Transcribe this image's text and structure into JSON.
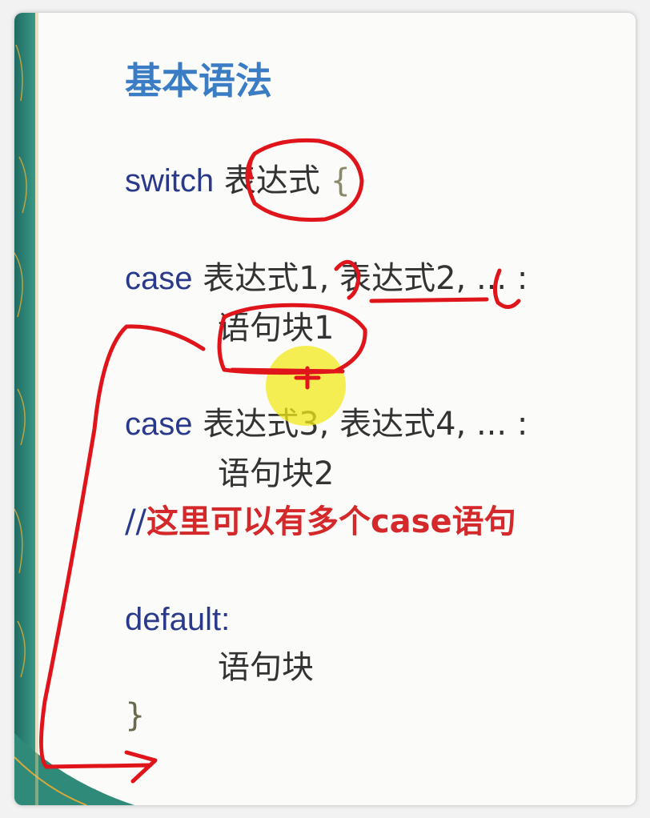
{
  "slide": {
    "title": "基本语法",
    "switch_kw": "switch",
    "switch_expr": "表达式",
    "open_brace": "{",
    "case1_kw": "case",
    "case1_rest": " 表达式1, 表达式2, ... :",
    "block1": "语句块1",
    "case2_kw": "case",
    "case2_rest": " 表达式3, 表达式4, ... :",
    "block2": "语句块2",
    "comment_slash": "//",
    "comment_text": "这里可以有多个case语句",
    "default_kw": "default:",
    "default_block": "语句块",
    "close_brace": "}"
  },
  "colors": {
    "title": "#3a7dc4",
    "keyword": "#2a3a8a",
    "body": "#333333",
    "comment": "#d4282b",
    "annotation": "#e0141b",
    "highlight": "#f2ea1a",
    "decor_teal": "#2f8a7a",
    "decor_gold": "#d8a93a"
  }
}
